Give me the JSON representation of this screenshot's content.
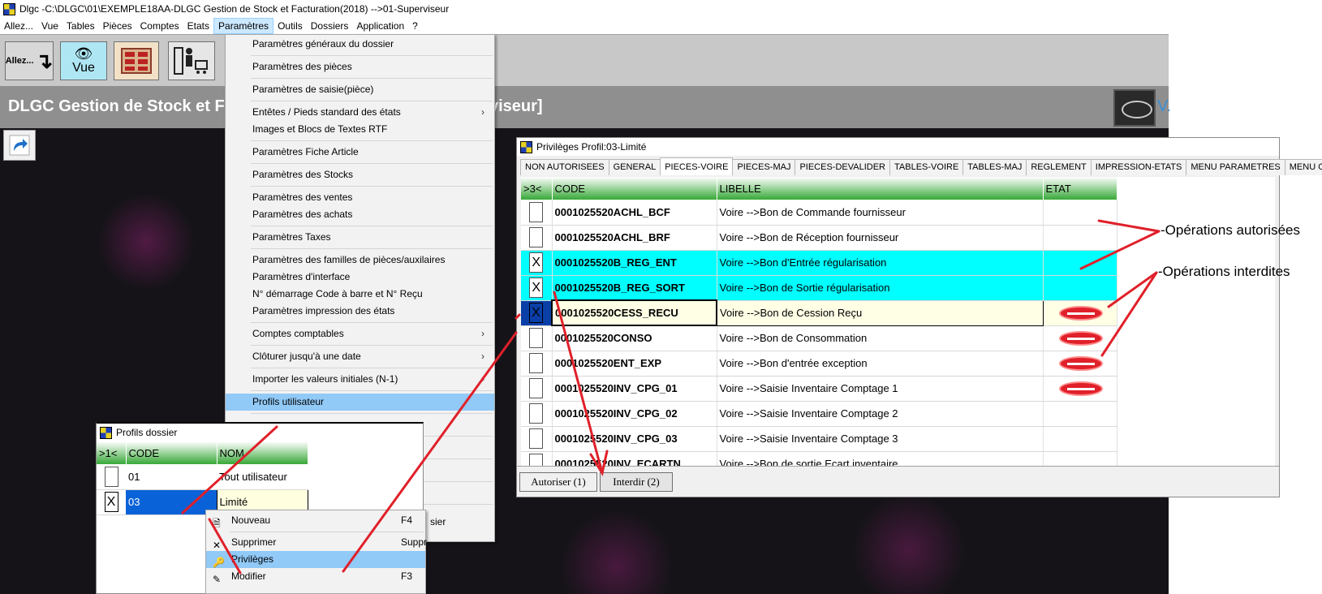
{
  "window": {
    "title": "Dlgc -C:\\DLGC\\01\\EXEMPLE18AA-DLGC Gestion de Stock et Facturation(2018) -->01-Superviseur"
  },
  "menubar": [
    "Allez...",
    "Vue",
    "Tables",
    "Pièces",
    "Comptes",
    "Etats",
    "Paramètres",
    "Outils",
    "Dossiers",
    "Application",
    "?"
  ],
  "toolbar": {
    "allez": "Allez...",
    "vue": "Vue"
  },
  "banner": {
    "title_left": "DLGC Gestion de Stock et F",
    "title_right": "viseur]",
    "version": "V."
  },
  "parametres_menu": [
    "Paramètres généraux du dossier",
    "Paramètres des pièces",
    "Paramètres de saisie(pièce)",
    "Entêtes / Pieds standard des états",
    "Images et Blocs de Textes RTF",
    "Paramètres Fiche Article",
    "Paramètres des Stocks",
    "Paramètres des ventes",
    "Paramètres des achats",
    "Paramètres Taxes",
    "Paramètres des familles de pièces/auxilaires",
    "Paramètres d'interface",
    "N° démarrage Code à barre et N° Reçu",
    "Paramètres impression des états",
    "Comptes comptables",
    "Clôturer jusqu'à une date",
    "Importer les valeurs initiales (N-1)",
    "Profils utilisateur"
  ],
  "privileges": {
    "title": "Privilèges Profil:03-Limité",
    "tabs": [
      "NON AUTORISEES",
      "GENERAL",
      "PIECES-VOIRE",
      "PIECES-MAJ",
      "PIECES-DEVALIDER",
      "TABLES-VOIRE",
      "TABLES-MAJ",
      "REGLEMENT",
      "IMPRESSION-ETATS",
      "MENU PARAMETRES",
      "MENU OUTILS"
    ],
    "columns": [
      ">3<",
      "CODE",
      "LIBELLE",
      "ETAT"
    ],
    "rows": [
      {
        "checked": "",
        "code": "0001025520ACHL_BCF",
        "libelle": "Voire -->Bon de Commande fournisseur",
        "etat": ""
      },
      {
        "checked": "",
        "code": "0001025520ACHL_BRF",
        "libelle": "Voire -->Bon de Réception fournisseur",
        "etat": ""
      },
      {
        "checked": "X",
        "code": "0001025520B_REG_ENT",
        "libelle": "Voire -->Bon d'Entrée régularisation",
        "etat": ""
      },
      {
        "checked": "X",
        "code": "0001025520B_REG_SORT",
        "libelle": "Voire -->Bon de Sortie régularisation",
        "etat": ""
      },
      {
        "checked": "X",
        "code": "0001025520CESS_RECU",
        "libelle": "Voire -->Bon de Cession Reçu",
        "etat": "interdit"
      },
      {
        "checked": "",
        "code": "0001025520CONSO",
        "libelle": "Voire -->Bon de Consommation",
        "etat": "interdit"
      },
      {
        "checked": "",
        "code": "0001025520ENT_EXP",
        "libelle": "Voire -->Bon d'entrée exception",
        "etat": "interdit"
      },
      {
        "checked": "",
        "code": "0001025520INV_CPG_01",
        "libelle": "Voire -->Saisie Inventaire Comptage 1",
        "etat": "interdit"
      },
      {
        "checked": "",
        "code": "0001025520INV_CPG_02",
        "libelle": "Voire -->Saisie Inventaire Comptage 2",
        "etat": ""
      },
      {
        "checked": "",
        "code": "0001025520INV_CPG_03",
        "libelle": "Voire -->Saisie Inventaire Comptage 3",
        "etat": ""
      },
      {
        "checked": "",
        "code": "0001025520INV_ECARTN",
        "libelle": "Voire -->Bon de sortie Ecart inventaire",
        "etat": ""
      }
    ],
    "buttons": {
      "autoriser": "Autoriser (1)",
      "interdir": "Interdir (2)"
    }
  },
  "profils": {
    "title": "Profils dossier",
    "columns": [
      ">1<",
      "CODE",
      "NOM"
    ],
    "rows": [
      {
        "checked": "",
        "code": "01",
        "nom": "Tout utilisateur"
      },
      {
        "checked": "X",
        "code": "03",
        "nom": "Limité"
      }
    ]
  },
  "context_menu": [
    {
      "label": "Nouveau",
      "shortcut": "F4"
    },
    {
      "label": "Supprimer",
      "shortcut": "Suppr"
    },
    {
      "label": "Privilèges",
      "shortcut": ""
    },
    {
      "label": "Modifier",
      "shortcut": "F3"
    }
  ],
  "stray_text": "sier",
  "annotations": {
    "autorisees": "-Opérations autorisées",
    "interdites": "-Opérations interdites"
  },
  "colors": {
    "allowed_row": "#00ffff",
    "menu_highlight": "#91c9f7",
    "header_green": "#38a838",
    "arrow_red": "#e0202a"
  }
}
